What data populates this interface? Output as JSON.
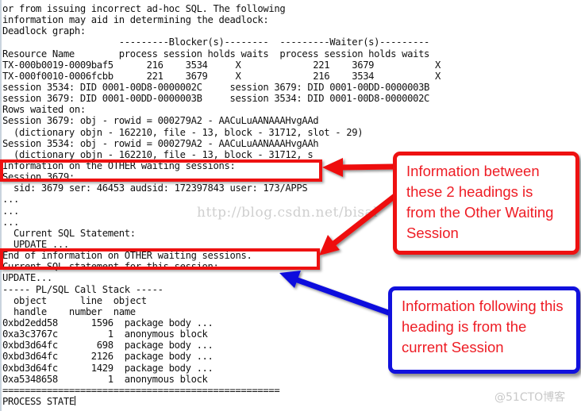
{
  "trace": {
    "lines": [
      "or from issuing incorrect ad-hoc SQL. The following",
      "information may aid in determining the deadlock:",
      "Deadlock graph:",
      "                     ---------Blocker(s)--------  ---------Waiter(s)---------",
      "Resource Name        process session holds waits  process session holds waits",
      "TX-000b0019-0009baf5      216    3534     X             221    3679           X",
      "TX-000f0010-0006fcbb      221    3679     X             216    3534           X",
      "session 3534: DID 0001-00D8-0000002C     session 3679: DID 0001-00DD-0000003B",
      "session 3679: DID 0001-00DD-0000003B     session 3534: DID 0001-00D8-0000002C",
      "Rows waited on:",
      "Session 3679: obj - rowid = 000279A2 - AACuLuAANAAAHvgAAd",
      "  (dictionary objn - 162210, file - 13, block - 31712, slot - 29)",
      "Session 3534: obj - rowid = 000279A2 - AACuLuAANAAAHvgAAh",
      "  (dictionary objn - 162210, file - 13, block - 31712, s",
      "Information on the OTHER waiting sessions:",
      "Session 3679:",
      "  sid: 3679 ser: 46453 audsid: 172397843 user: 173/APPS",
      "...",
      "...",
      "...",
      "  Current SQL Statement:",
      "  UPDATE ...",
      "End of information on OTHER waiting sessions.",
      "Current SQL statement for this session:",
      "UPDATE...",
      "----- PL/SQL Call Stack -----",
      "  object      line  object",
      "  handle    number  name",
      "0xbd2edd58      1596  package body ...",
      "0xa3c3767c         1  anonymous block",
      "0xbd3d64fc       698  package body ...",
      "0xbd3d64fc      2126  package body ...",
      "0xbd3d64fc      1429  package body ...",
      "0xa5348658         1  anonymous block",
      "==================================================",
      "PROCESS STATE"
    ]
  },
  "annotations": {
    "other_session": {
      "text": "Information between these 2 headings is from the Other Waiting Session",
      "border_color": "#ee1111",
      "text_color": "#ee1c24"
    },
    "current_session": {
      "text": "Information following this heading is from the current  Session",
      "border_color": "#1111dd",
      "text_color": "#ee1c24"
    },
    "highlight_start": "Information on the OTHER waiting sessions:",
    "highlight_end": "End of information on OTHER waiting sessions."
  },
  "watermarks": {
    "blog_url": "http://blog.csdn.net/bisal",
    "site_tag": "@51CTO博客"
  }
}
